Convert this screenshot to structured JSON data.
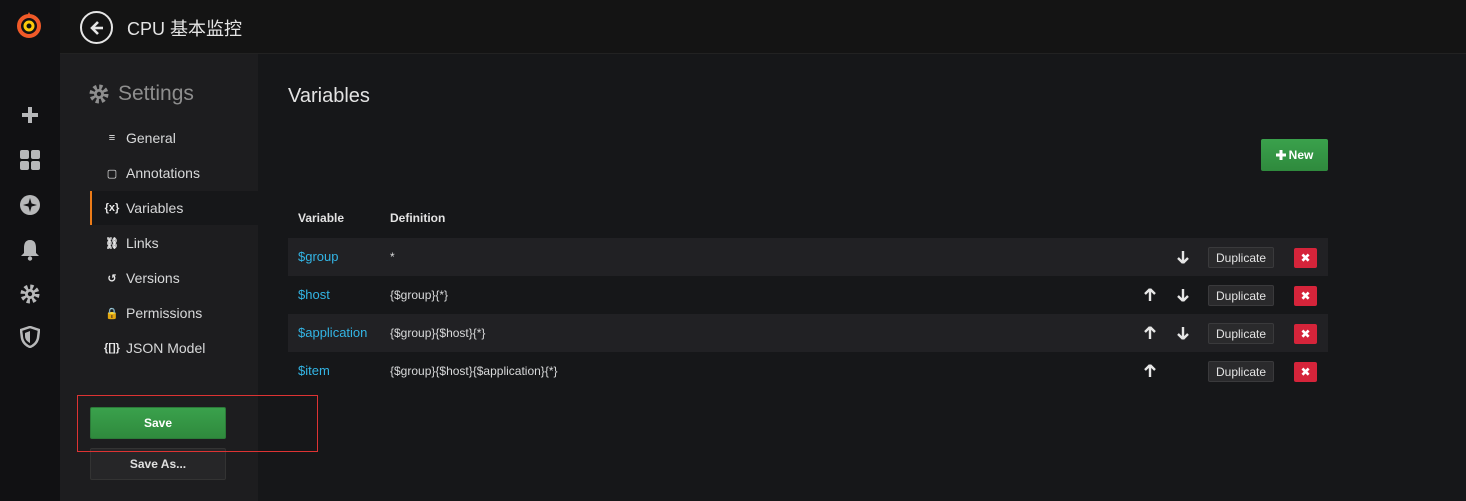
{
  "header": {
    "dashboard_title": "CPU 基本监控"
  },
  "settings_menu": {
    "title": "Settings",
    "items": [
      {
        "label": "General",
        "icon": "sliders-icon",
        "glyph": "≡"
      },
      {
        "label": "Annotations",
        "icon": "comment-icon",
        "glyph": "▢"
      },
      {
        "label": "Variables",
        "icon": "variable-icon",
        "glyph": "{x}",
        "active": true
      },
      {
        "label": "Links",
        "icon": "link-icon",
        "glyph": "⛓"
      },
      {
        "label": "Versions",
        "icon": "history-icon",
        "glyph": "↺"
      },
      {
        "label": "Permissions",
        "icon": "lock-icon",
        "glyph": "🔒"
      },
      {
        "label": "JSON Model",
        "icon": "json-icon",
        "glyph": "{[]}"
      }
    ],
    "save_label": "Save",
    "save_as_label": "Save As..."
  },
  "main": {
    "title": "Variables",
    "new_button": "New",
    "columns": {
      "variable": "Variable",
      "definition": "Definition"
    },
    "rows": [
      {
        "name": "$group",
        "definition": "*",
        "can_up": false,
        "can_down": true
      },
      {
        "name": "$host",
        "definition": "{$group}{*}",
        "can_up": true,
        "can_down": true
      },
      {
        "name": "$application",
        "definition": "{$group}{$host}{*}",
        "can_up": true,
        "can_down": true
      },
      {
        "name": "$item",
        "definition": "{$group}{$host}{$application}{*}",
        "can_up": true,
        "can_down": false
      }
    ],
    "duplicate_label": "Duplicate",
    "delete_glyph": "✖"
  },
  "colors": {
    "accent_green": "#3aa14c",
    "link_blue": "#33b5e5",
    "danger_red": "#d5243a",
    "active_orange": "#eb7b18"
  }
}
